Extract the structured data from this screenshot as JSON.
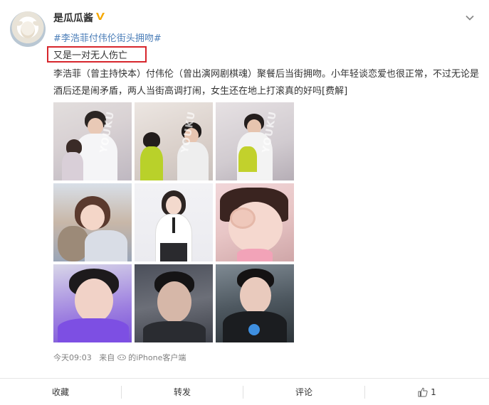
{
  "user": {
    "name": "是瓜瓜酱"
  },
  "post": {
    "topic": "#李浩菲付伟伦街头拥吻#",
    "highlight": "又是一对无人伤亡",
    "body": "李浩菲（曾主持快本）付伟伦（曾出演网剧棋魂）聚餐后当街拥吻。小年轻谈恋爱也很正常，不过无论是酒后还是闹矛盾，两人当街高调打闹，女生还在地上打滚真的好吗[费解]",
    "watermark": "YOUKU",
    "time": "今天09:03",
    "source_prefix": "来自",
    "source": "的iPhone客户端"
  },
  "actions": {
    "favorite": "收藏",
    "repost": "转发",
    "comment": "评论",
    "like_count": "1"
  },
  "colors": {
    "topic": "#eb7350",
    "highlight_border": "#d7262c",
    "verified": "#f6a800"
  }
}
